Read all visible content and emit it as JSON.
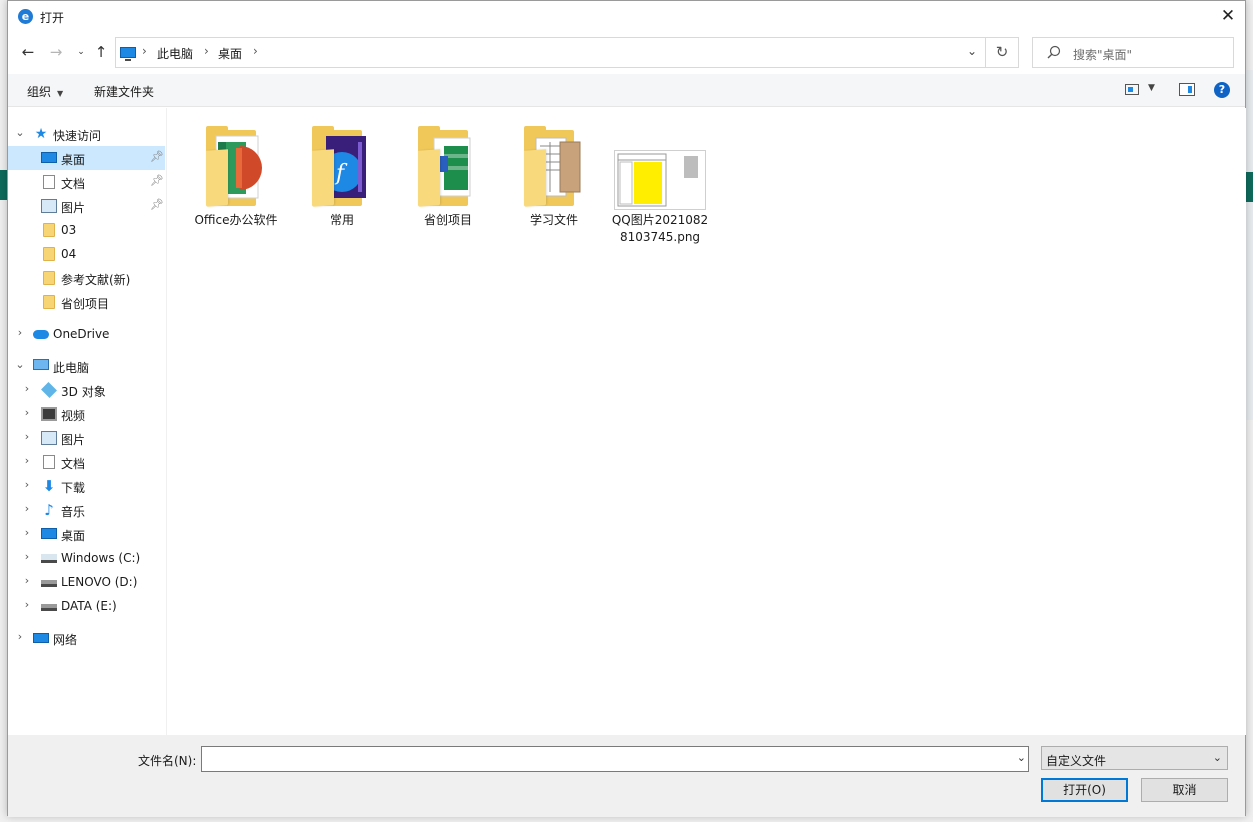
{
  "window": {
    "title": "打开"
  },
  "breadcrumb": {
    "items": [
      "此电脑",
      "桌面"
    ]
  },
  "search": {
    "placeholder": "搜索\"桌面\""
  },
  "toolbar": {
    "organize": "组织",
    "new_folder": "新建文件夹"
  },
  "quick_access": {
    "label": "快速访问",
    "items": [
      {
        "label": "桌面",
        "icon": "desktop-icon",
        "pinned": true,
        "selected": true
      },
      {
        "label": "文档",
        "icon": "document-icon",
        "pinned": true
      },
      {
        "label": "图片",
        "icon": "picture-icon",
        "pinned": true
      },
      {
        "label": "03",
        "icon": "folder-icon"
      },
      {
        "label": "04",
        "icon": "folder-icon"
      },
      {
        "label": "参考文献(新)",
        "icon": "folder-icon"
      },
      {
        "label": "省创项目",
        "icon": "folder-icon"
      }
    ]
  },
  "onedrive": {
    "label": "OneDrive"
  },
  "this_pc": {
    "label": "此电脑",
    "items": [
      {
        "label": "3D 对象",
        "icon": "3d-objects-icon"
      },
      {
        "label": "视频",
        "icon": "video-icon"
      },
      {
        "label": "图片",
        "icon": "picture-icon"
      },
      {
        "label": "文档",
        "icon": "document-icon"
      },
      {
        "label": "下载",
        "icon": "download-icon"
      },
      {
        "label": "音乐",
        "icon": "music-icon"
      },
      {
        "label": "桌面",
        "icon": "desktop-icon"
      },
      {
        "label": "Windows (C:)",
        "icon": "windows-drive-icon"
      },
      {
        "label": "LENOVO (D:)",
        "icon": "drive-icon"
      },
      {
        "label": "DATA (E:)",
        "icon": "drive-icon"
      }
    ]
  },
  "network": {
    "label": "网络"
  },
  "files": [
    {
      "name": "Office办公软件",
      "type": "folder",
      "icon": "office-folder-icon"
    },
    {
      "name": "常用",
      "type": "folder",
      "icon": "flash-folder-icon"
    },
    {
      "name": "省创项目",
      "type": "folder",
      "icon": "docs-folder-icon"
    },
    {
      "name": "学习文件",
      "type": "folder",
      "icon": "papers-folder-icon"
    },
    {
      "name": "QQ图片20210828103745.png",
      "type": "image",
      "icon": "image-thumbnail-icon"
    }
  ],
  "bottom": {
    "filename_label": "文件名(N):",
    "filename_value": "",
    "filetype_value": "自定义文件",
    "open_button": "打开(O)",
    "cancel_button": "取消"
  }
}
